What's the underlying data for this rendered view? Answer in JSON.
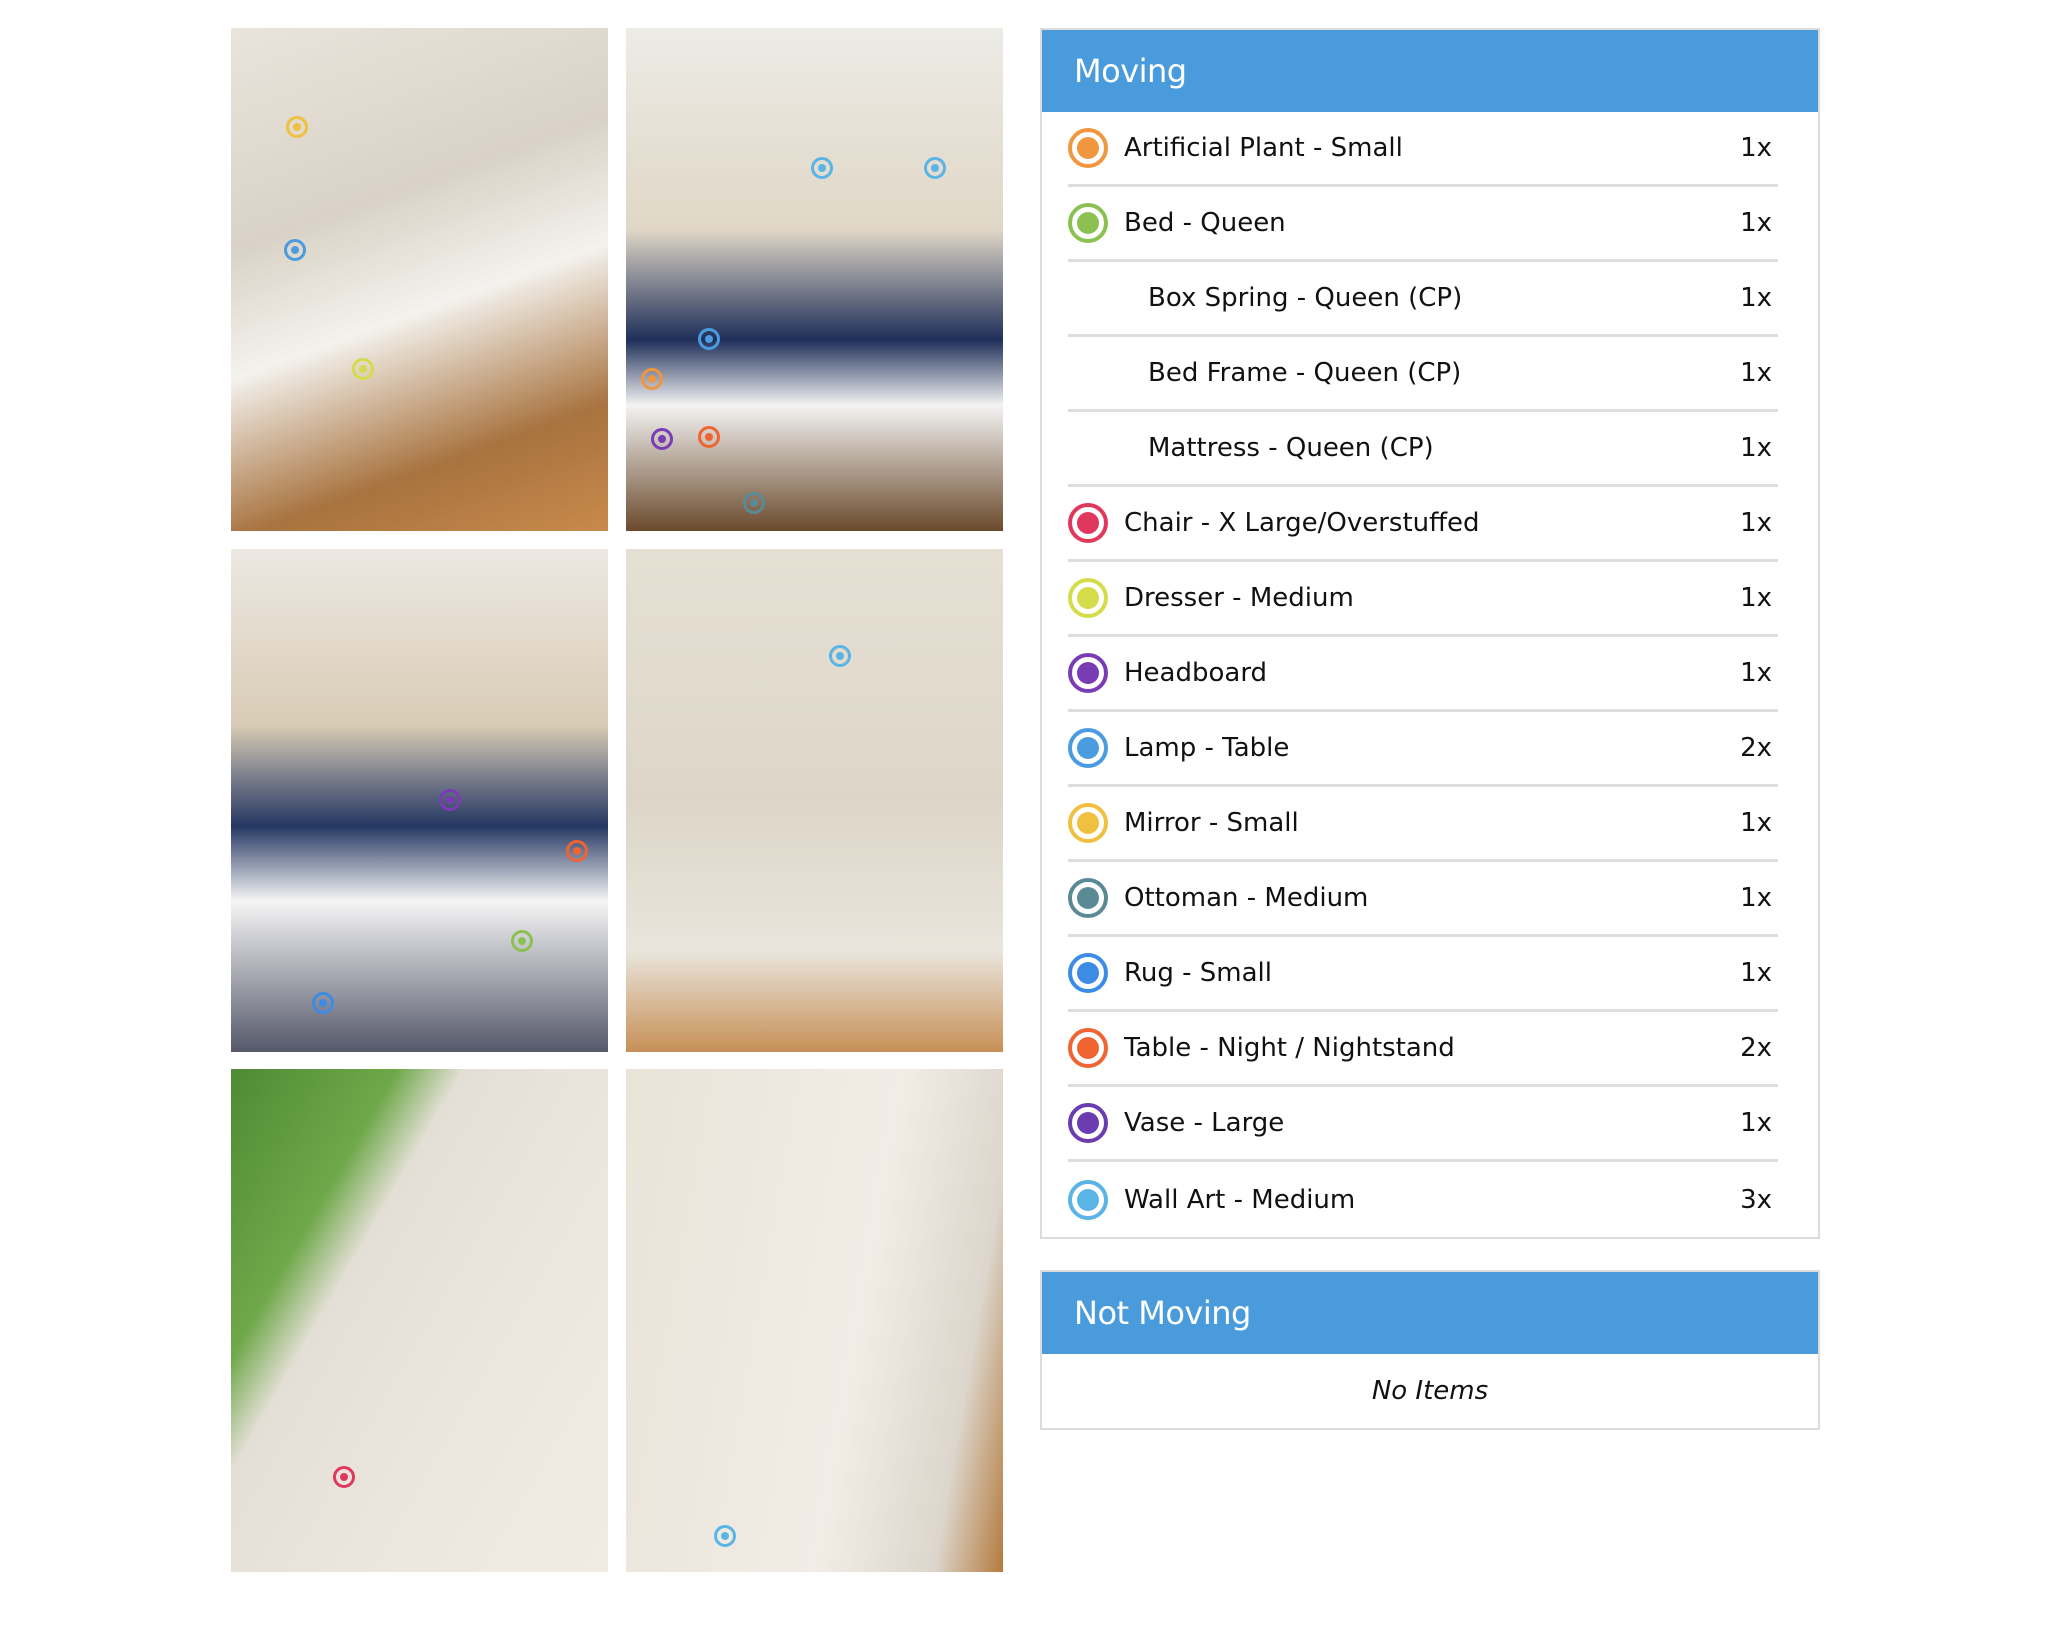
{
  "photos": [
    {
      "alt": "dresser-and-door",
      "bg": "linear-gradient(160deg,#e9e4dc 0%,#d9d2c6 35%,#f4f2ee 55%,#a8733f 80%,#c88a4c 100%)"
    },
    {
      "alt": "bed-with-wall-art",
      "bg": "linear-gradient(180deg,#ecebe6 0%,#e0d7c6 40%,#1f2f5a 62%,#f3f3f3 75%,#6b4a2c 100%)"
    },
    {
      "alt": "bed-wide-view",
      "bg": "linear-gradient(180deg,#ece8e2 0%,#d9ccb6 35%,#243763 55%,#f5f5f5 70%,#55586a 100%)"
    },
    {
      "alt": "shelf-corner",
      "bg": "linear-gradient(180deg,#e6e0d4 0%,#ddd6c8 50%,#e9e5dc 80%,#c79057 100%)"
    },
    {
      "alt": "chair-and-window",
      "bg": "linear-gradient(120deg,#4f8a34 0%,#6fa84a 25%,#e4dfd6 35%,#ece8e0 70%,#f0ebe3 100%)"
    },
    {
      "alt": "hats-on-wall",
      "bg": "linear-gradient(100deg,#e9e3d8 0%,#f1ede6 60%,#dcd6cc 85%,#b47a3e 100%)"
    }
  ],
  "moving": {
    "title": "Moving",
    "items": [
      {
        "label": "Artificial Plant - Small",
        "qty": "1x",
        "color": "#f0963c"
      },
      {
        "label": "Bed - Queen",
        "qty": "1x",
        "color": "#8cc152"
      },
      {
        "label": "Box Spring - Queen (CP)",
        "qty": "1x",
        "sub": true
      },
      {
        "label": "Bed Frame - Queen (CP)",
        "qty": "1x",
        "sub": true
      },
      {
        "label": "Mattress - Queen (CP)",
        "qty": "1x",
        "sub": true
      },
      {
        "label": "Chair - X Large/Overstuffed",
        "qty": "1x",
        "color": "#e0385c"
      },
      {
        "label": "Dresser - Medium",
        "qty": "1x",
        "color": "#d4dc4a"
      },
      {
        "label": "Headboard",
        "qty": "1x",
        "color": "#7a3cb4"
      },
      {
        "label": "Lamp - Table",
        "qty": "2x",
        "color": "#4a9be0"
      },
      {
        "label": "Mirror - Small",
        "qty": "1x",
        "color": "#f0c040"
      },
      {
        "label": "Ottoman - Medium",
        "qty": "1x",
        "color": "#5a8a96"
      },
      {
        "label": "Rug - Small",
        "qty": "1x",
        "color": "#3c8ce6"
      },
      {
        "label": "Table - Night / Nightstand",
        "qty": "2x",
        "color": "#f06432"
      },
      {
        "label": "Vase - Large",
        "qty": "1x",
        "color": "#6a3cb0"
      },
      {
        "label": "Wall Art - Medium",
        "qty": "3x",
        "color": "#5ab4e6"
      }
    ]
  },
  "not_moving": {
    "title": "Not Moving",
    "empty_text": "No Items"
  },
  "accent_color": "#4a9bdc"
}
